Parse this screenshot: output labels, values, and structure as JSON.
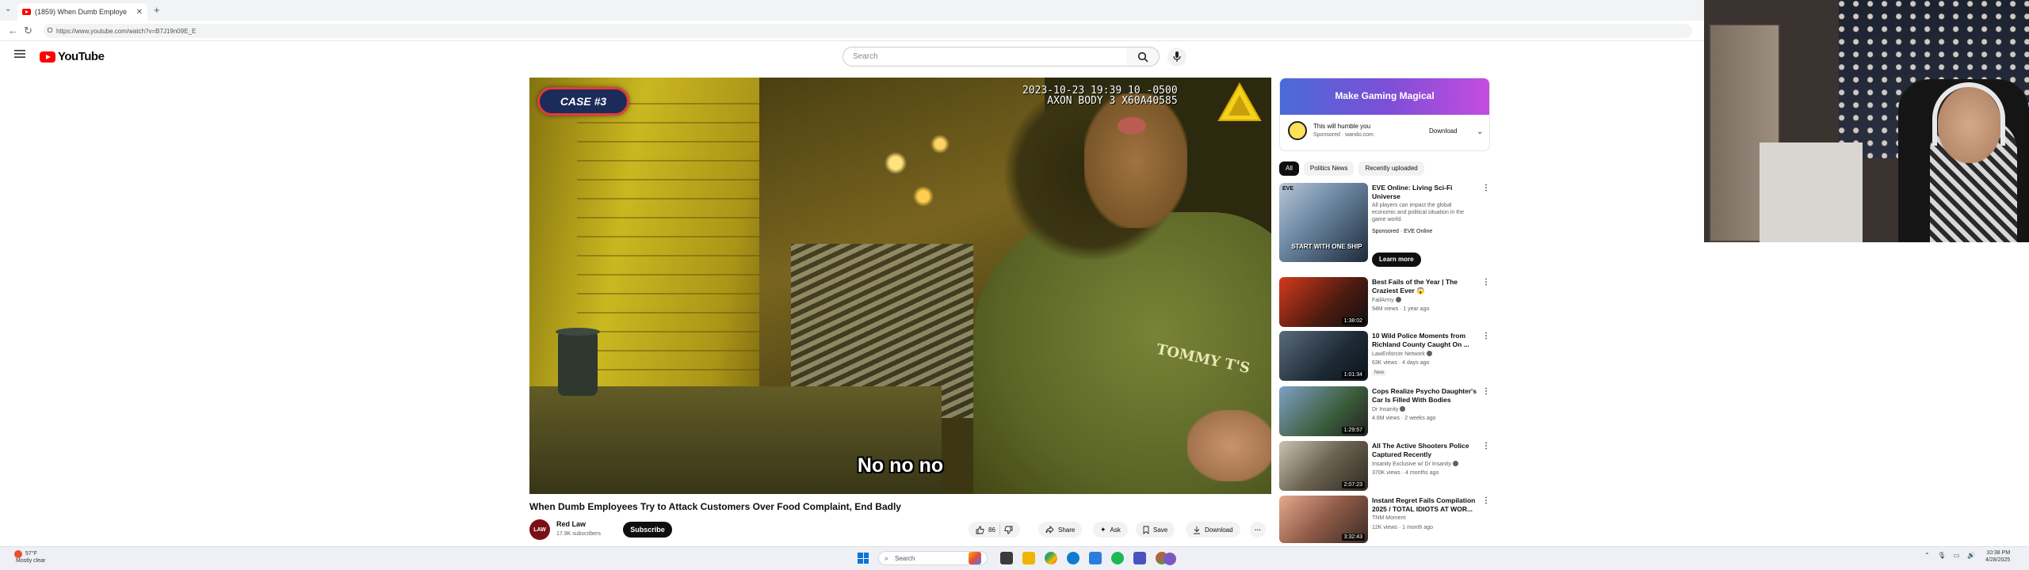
{
  "browser": {
    "tab_title": "(1859) When Dumb Employe",
    "url": "https://www.youtube.com/watch?v=B7J19n09E_E"
  },
  "youtube": {
    "logo_text": "YouTube",
    "search_placeholder": "Search",
    "brand_color": "#ff0000"
  },
  "video": {
    "case_label": "CASE #3",
    "timestamp_line1": "2023-10-23 19:39 10 -0500",
    "timestamp_line2": "AXON BODY 3 X60A40585",
    "caption": "No no no",
    "shirt_text": "TOMMY T'S",
    "title": "When Dumb Employees Try to Attack Customers Over Food Complaint, End Badly"
  },
  "channel": {
    "avatar_text": "LAW",
    "name": "Red Law",
    "subscribers": "17.9K subscribers",
    "subscribe_label": "Subscribe"
  },
  "actions": {
    "like_count": "86",
    "share": "Share",
    "ask": "Ask",
    "save": "Save",
    "download": "Download"
  },
  "sidebar": {
    "ad": {
      "banner": "Make Gaming Magical",
      "title": "This will humble you",
      "sponsor": "Sponsored · wando.com",
      "download": "Download"
    },
    "chips": [
      "All",
      "Politics News",
      "Recently uploaded"
    ],
    "recs": [
      {
        "title": "EVE Online: Living Sci-Fi Universe",
        "desc": "All players can impact the global economic and political situation in the game world.",
        "sponsor": "Sponsored · EVE Online",
        "cta": "Learn more",
        "thumb_text": "START WITH ONE SHIP"
      },
      {
        "title": "Best Fails of the Year | The Craziest Ever 😱",
        "channel": "FailArmy",
        "meta": "94M views · 1 year ago",
        "duration": "1:38:02"
      },
      {
        "title": "10 Wild Police Moments from Richland County Caught On ...",
        "channel": "LawEnforcer Network",
        "meta": "63K views · 4 days ago",
        "badge": "New",
        "duration": "1:01:34"
      },
      {
        "title": "Cops Realize Psycho Daughter's Car Is Filled With Bodies",
        "channel": "Dr Insanity",
        "meta": "4.6M views · 2 weeks ago",
        "duration": "1:29:57"
      },
      {
        "title": "All The Active Shooters Police Captured Recently",
        "channel": "Insanity Exclusive w/ Dr Insanity",
        "meta": "370K views · 4 months ago",
        "duration": "2:07:23"
      },
      {
        "title": "Instant Regret Fails Compilation 2025 / TOTAL IDIOTS AT WOR...",
        "channel": "TNM Moment",
        "meta": "12K views · 1 month ago",
        "duration": "3:32:43"
      }
    ]
  },
  "taskbar": {
    "weather_temp": "57°F",
    "weather_desc": "Mostly clear",
    "search": "Search",
    "time": "10:38 PM",
    "date": "4/28/2025"
  }
}
